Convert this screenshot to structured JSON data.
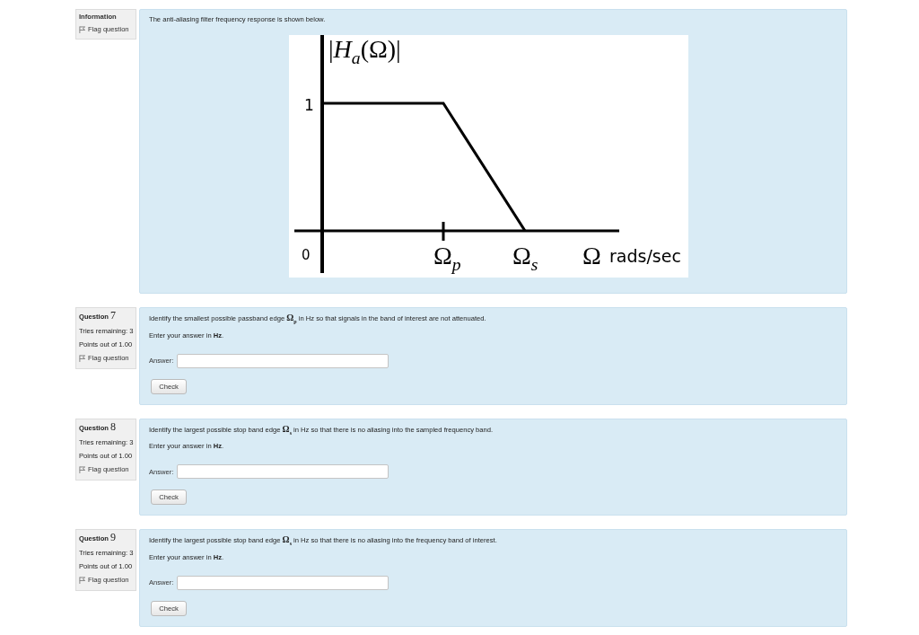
{
  "items": [
    {
      "kind": "description",
      "info": {
        "title": "Information",
        "flag": "Flag question"
      },
      "text": "The anti-aliasing filter frequency response is shown below.",
      "figure": {
        "y_axis_label": "|*H*$_{a}$(Ω)|",
        "y_tick": "1",
        "origin": "0",
        "x_marks": [
          "Ω$_{p}$",
          "Ω$_{s}$"
        ],
        "x_symbol": "Ω",
        "x_unit": "rads/sec"
      }
    },
    {
      "kind": "question",
      "info": {
        "label": "Question",
        "number": "7",
        "tries": "Tries remaining: 3",
        "points": "Points out of 1.00",
        "flag": "Flag question"
      },
      "text": "Identify the smallest possible passband edge **Ω**$_{p}$ in Hz so that signals in the band of interest are not attenuated.",
      "instruction": "Enter your answer in **Hz**.",
      "answer_label": "Answer:",
      "button": "Check"
    },
    {
      "kind": "question",
      "info": {
        "label": "Question",
        "number": "8",
        "tries": "Tries remaining: 3",
        "points": "Points out of 1.00",
        "flag": "Flag question"
      },
      "text": "Identify the largest possible stop band edge **Ω**$_{s}$ in Hz so that there is no aliasing into the sampled frequency band.",
      "instruction": "Enter your answer in **Hz**.",
      "answer_label": "Answer:",
      "button": "Check"
    },
    {
      "kind": "question",
      "info": {
        "label": "Question",
        "number": "9",
        "tries": "Tries remaining: 3",
        "points": "Points out of 1.00",
        "flag": "Flag question"
      },
      "text": "Identify the largest possible stop band edge **Ω**$_{s}$ in Hz so that there is no aliasing into the frequency band of interest.",
      "instruction": "Enter your answer in **Hz**.",
      "answer_label": "Answer:",
      "button": "Check"
    }
  ]
}
